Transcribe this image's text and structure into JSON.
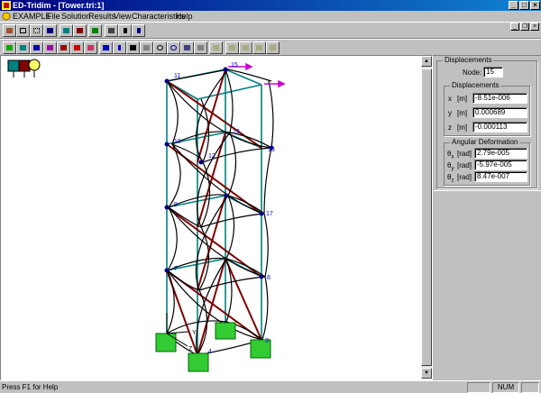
{
  "window": {
    "title": "ED-Tridim - [Tower.tri:1]"
  },
  "menu": {
    "items": [
      "EXAMPLE",
      "File",
      "Solution",
      "Results",
      "View",
      "Characteristics",
      "Help"
    ]
  },
  "panel": {
    "group_title": "Displacements",
    "node_label": "Node:",
    "node_value": "15",
    "disp_title": "Displacements",
    "disp_rows": [
      {
        "axis": "x",
        "unit": "[m]",
        "value": "-8.51e-006"
      },
      {
        "axis": "y",
        "unit": "[m]",
        "value": "0.000689"
      },
      {
        "axis": "z",
        "unit": "[m]",
        "value": "-0.000113"
      }
    ],
    "ang_title": "Angular Deformation",
    "ang_rows": [
      {
        "axis": "θ",
        "sub": "x",
        "unit": "[rad]",
        "value": "2.79e-005"
      },
      {
        "axis": "θ",
        "sub": "y",
        "unit": "[rad]",
        "value": "-5.97e-005"
      },
      {
        "axis": "θ",
        "sub": "z",
        "unit": "[rad]",
        "value": "8.47e-007"
      }
    ]
  },
  "model": {
    "node_labels": [
      "11",
      "15",
      "13",
      "16",
      "12",
      "10",
      "9",
      "17",
      "7",
      "8",
      "3",
      "4"
    ],
    "axis_labels": [
      "Y",
      "Z"
    ]
  },
  "colors": {
    "teal": "#008080",
    "brown": "#800000",
    "support": "#33cc33",
    "label": "#0000cc",
    "load": "#cc00cc"
  },
  "status": {
    "help_text": "Press F1 for Help",
    "num": "NUM"
  }
}
